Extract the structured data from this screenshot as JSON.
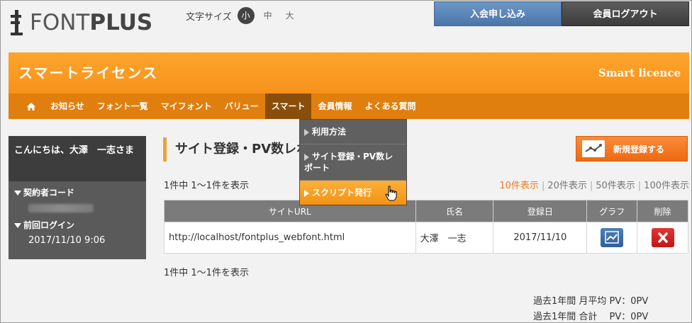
{
  "header": {
    "logo_light": "FONT",
    "logo_bold": "PLUS",
    "fontsize_label": "文字サイズ",
    "fontsize_options": [
      "小",
      "中",
      "大"
    ],
    "join_button": "入会申し込み",
    "logout_button": "会員ログアウト"
  },
  "banner": {
    "title": "スマートライセンス",
    "subtitle": "Smart licence"
  },
  "nav": {
    "items": [
      "お知らせ",
      "フォント一覧",
      "マイフォント",
      "バリュー",
      "スマート",
      "会員情報",
      "よくある質問"
    ]
  },
  "dropdown": {
    "items": [
      "利用方法",
      "サイト登録・PV数レポート",
      "スクリプト発行"
    ]
  },
  "sidebar": {
    "greeting": "こんにちは、大澤　一志さま",
    "contract_label": "契約者コード",
    "last_login_label": "前回ログイン",
    "last_login_value": "2017/11/10 9:06"
  },
  "main": {
    "title": "サイト登録・PV数レポート",
    "new_button": "新規登録する",
    "count_text": "1件中 1～1件を表示",
    "pager": [
      "10件表示",
      "20件表示",
      "50件表示",
      "100件表示"
    ],
    "table": {
      "headers": [
        "サイトURL",
        "氏名",
        "登録日",
        "グラフ",
        "削除"
      ],
      "rows": [
        {
          "url": "http://localhost/fontplus_webfont.html",
          "name": "大澤　一志",
          "date": "2017/11/10"
        }
      ]
    },
    "pv_monthly": "過去1年間 月平均 PV：0PV",
    "pv_total": "過去1年間 合計　 PV：0PV"
  },
  "colors": {
    "accent_orange": "#f7921b",
    "nav_orange": "#e07f0e",
    "blue_button": "#4b76a8",
    "delete_red": "#c01717"
  }
}
